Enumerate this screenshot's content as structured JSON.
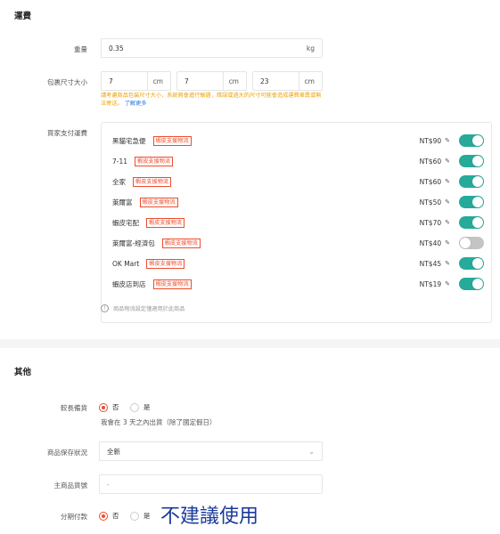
{
  "shipping": {
    "title": "運費",
    "weight": {
      "label": "重量",
      "value": "0.35",
      "unit": "kg"
    },
    "dimensions": {
      "label": "包裹尺寸大小",
      "values": [
        "7",
        "7",
        "23"
      ],
      "unit": "cm"
    },
    "warning": "請考慮商品包裝尺寸大小，系統將會進行驗證，錯誤或過大的尺寸可能會造成運費差異或無法寄送。",
    "learn_more": "了解更多",
    "fee_label": "買家支付運費",
    "tag_label": "蝦皮支援物流",
    "methods": [
      {
        "name": "黑貓宅急便",
        "price": "NT$90",
        "enabled": true
      },
      {
        "name": "7-11",
        "price": "NT$60",
        "enabled": true
      },
      {
        "name": "全家",
        "price": "NT$60",
        "enabled": true
      },
      {
        "name": "萊爾富",
        "price": "NT$50",
        "enabled": true
      },
      {
        "name": "蝦皮宅配",
        "price": "NT$70",
        "enabled": true
      },
      {
        "name": "萊爾富-經濟包",
        "price": "NT$40",
        "enabled": false
      },
      {
        "name": "OK Mart",
        "price": "NT$45",
        "enabled": true
      },
      {
        "name": "蝦皮店到店",
        "price": "NT$19",
        "enabled": true
      }
    ],
    "note": "商品物流設定僅適用於此商品"
  },
  "other": {
    "title": "其他",
    "preorder": {
      "label": "較長備貨",
      "options": [
        "否",
        "是"
      ],
      "selected": "否",
      "hint": "我會在 3 天之內出貨（除了國定假日）"
    },
    "condition": {
      "label": "商品保存狀況",
      "value": "全新"
    },
    "sku": {
      "label": "主商品貨號",
      "value": "-"
    },
    "installment": {
      "label": "分期付款",
      "options": [
        "否",
        "是"
      ],
      "selected": "否"
    },
    "handwritten_note": "不建議使用"
  },
  "colors": {
    "accent": "#ee4d2d",
    "toggle_on": "#26aa99",
    "warning": "#f0a000",
    "link": "#2673dd",
    "handwriting": "#1a3a9c"
  }
}
